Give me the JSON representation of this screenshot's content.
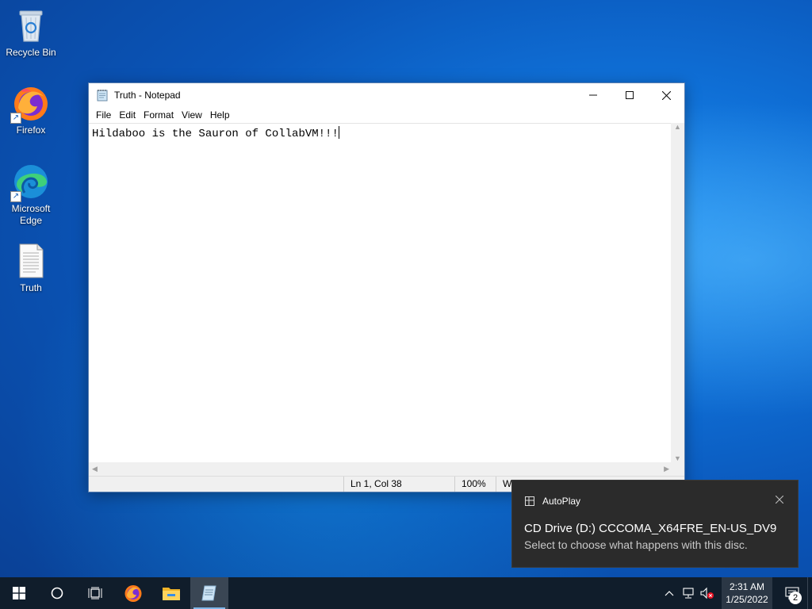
{
  "desktop": {
    "icons": [
      {
        "label": "Recycle Bin",
        "icon": "recycle-bin-icon"
      },
      {
        "label": "Firefox",
        "icon": "firefox-icon"
      },
      {
        "label": "Microsoft Edge",
        "icon": "edge-icon"
      },
      {
        "label": "Truth",
        "icon": "text-file-icon"
      }
    ]
  },
  "notepad": {
    "title": "Truth - Notepad",
    "menu": [
      "File",
      "Edit",
      "Format",
      "View",
      "Help"
    ],
    "content": "Hildaboo is the Sauron of CollabVM!!!",
    "status": {
      "position": "Ln 1, Col 38",
      "zoom": "100%",
      "line_ending": "Wi"
    }
  },
  "toast": {
    "app": "AutoPlay",
    "title": "CD Drive (D:) CCCOMA_X64FRE_EN-US_DV9",
    "body": "Select to choose what happens with this disc."
  },
  "taskbar": {
    "clock_time": "2:31 AM",
    "clock_date": "1/25/2022",
    "notification_count": "2",
    "pinned": [
      "start-icon",
      "search-icon",
      "task-view-icon",
      "firefox-icon",
      "file-explorer-icon",
      "notepad-icon"
    ]
  },
  "colors": {
    "taskbar": "#101d2b",
    "toast_bg": "#2b2b2b",
    "desktop_accent": "#0f6fd6"
  }
}
